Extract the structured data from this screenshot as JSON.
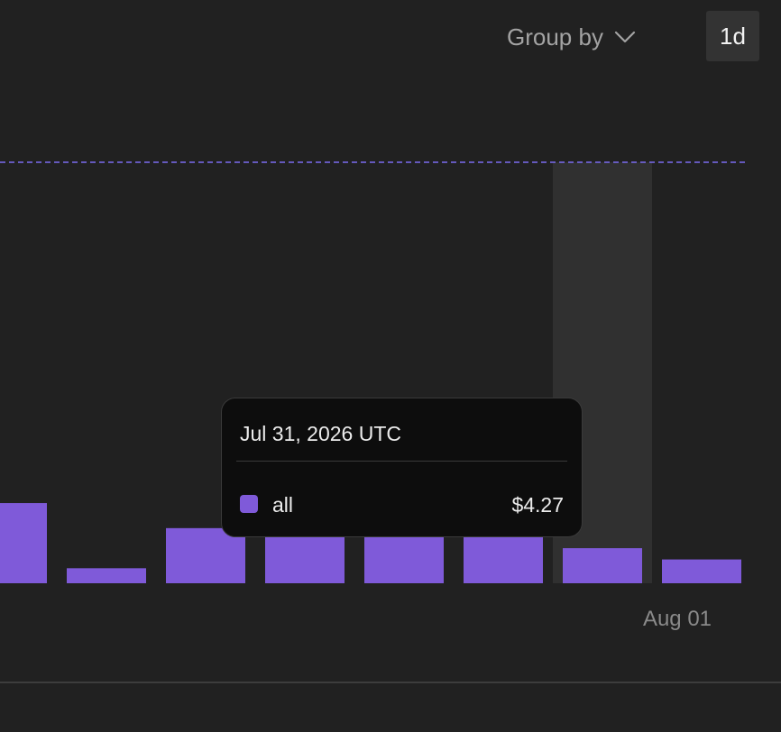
{
  "controls": {
    "group_by_label": "Group by",
    "interval_label": "1d"
  },
  "tooltip": {
    "date": "Jul 31, 2026 UTC",
    "series": "all",
    "value": "$4.27"
  },
  "colors": {
    "bar": "#7f5ad9",
    "reference_line": "#7a6cf0",
    "hover_band": "#303030"
  },
  "chart_data": {
    "type": "bar",
    "categories": [
      "",
      "",
      "",
      "",
      "",
      "",
      "Jul 31",
      "Aug 01"
    ],
    "x_tick_labels": [
      "Aug 01"
    ],
    "values": [
      3.2,
      0.6,
      2.2,
      2.2,
      2.2,
      2.2,
      1.4,
      0.95
    ],
    "hovered_index": 6,
    "reference_line": 16.8,
    "ylim": [
      0,
      16.8
    ],
    "grid": false,
    "legend": "none",
    "series": [
      {
        "name": "all",
        "values": [
          3.2,
          0.6,
          2.2,
          2.2,
          2.2,
          2.2,
          1.4,
          0.95
        ]
      }
    ]
  }
}
